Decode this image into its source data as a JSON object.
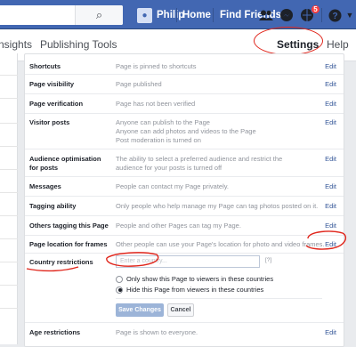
{
  "topbar": {
    "search_placeholder": "",
    "profile_name": "Philip",
    "home": "Home",
    "find_friends": "Find Friends",
    "notification_count": "5"
  },
  "header": {
    "tab_insights": "nsights",
    "tab_publishing_tools": "Publishing Tools",
    "tab_settings": "Settings",
    "help": "Help ▾"
  },
  "settings": {
    "rows": [
      {
        "label": "Shortcuts",
        "value": "Page is pinned to shortcuts",
        "edit": "Edit"
      },
      {
        "label": "Page visibility",
        "value": "Page published",
        "edit": "Edit"
      },
      {
        "label": "Page verification",
        "value": "Page has not been verified",
        "edit": "Edit"
      },
      {
        "label": "Visitor posts",
        "value": "Anyone can publish to the Page\nAnyone can add photos and videos to the Page\nPost moderation is turned on",
        "edit": "Edit"
      },
      {
        "label": "Audience optimisation for posts",
        "value": "The ability to select a preferred audience and restrict the audience for your posts is turned off",
        "edit": "Edit"
      },
      {
        "label": "Messages",
        "value": "People can contact my Page privately.",
        "edit": "Edit"
      },
      {
        "label": "Tagging ability",
        "value": "Only people who help manage my Page can tag photos posted on it.",
        "edit": "Edit"
      },
      {
        "label": "Others tagging this Page",
        "value": "People and other Pages can tag my Page.",
        "edit": "Edit"
      },
      {
        "label": "Page location for frames",
        "value": "Other people can use your Page's location for photo and video frames.",
        "edit": "Edit"
      },
      {
        "label": "Age restrictions",
        "value": "Page is shown to everyone.",
        "edit": "Edit"
      }
    ],
    "country": {
      "label": "Country restrictions",
      "input_placeholder": "Enter a country...",
      "help": "[?]",
      "option_only_show": "Only show this Page to viewers in these countries",
      "option_hide": "Hide this Page from viewers in these countries",
      "save": "Save Changes",
      "cancel": "Cancel"
    }
  },
  "colors": {
    "brand_blue": "#4267b2",
    "link": "#365899",
    "annotation_ink": "#e0251b"
  }
}
